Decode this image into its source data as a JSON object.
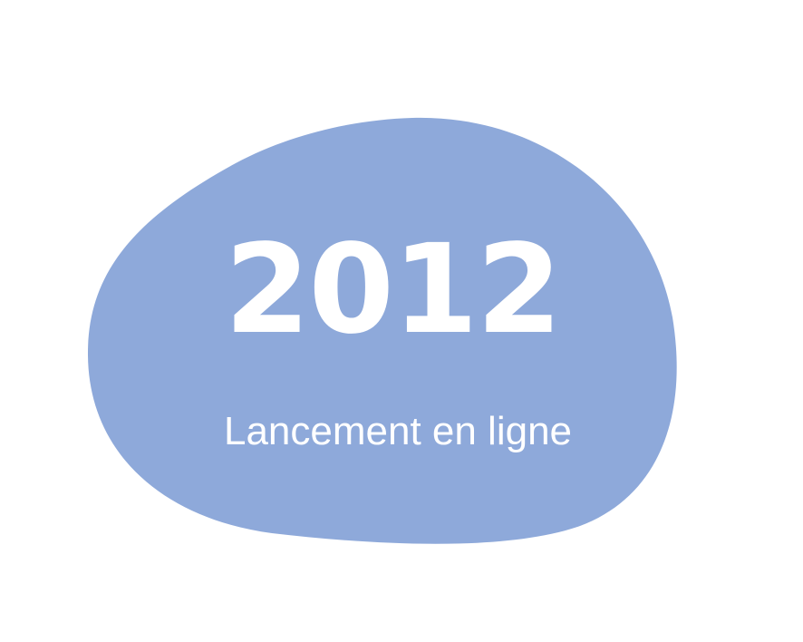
{
  "badge": {
    "year": "2012",
    "caption": "Lancement en ligne",
    "blob_color": "#8EA9DA",
    "text_color": "#FFFFFF",
    "background": "#FFFFFF"
  }
}
